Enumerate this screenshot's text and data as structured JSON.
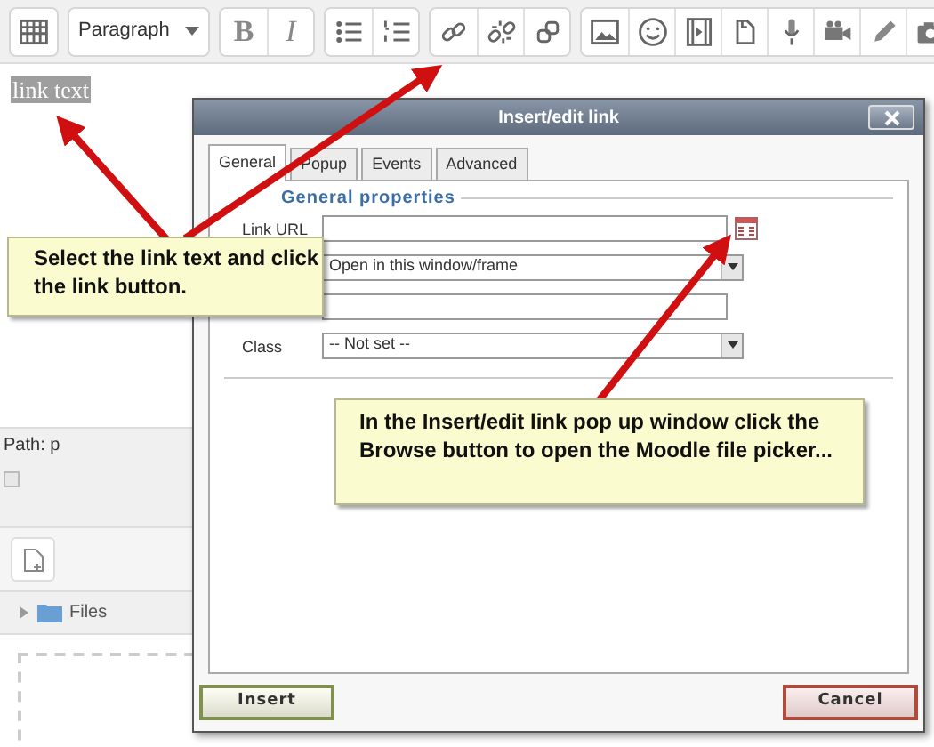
{
  "toolbar": {
    "format_select": "Paragraph",
    "groups": [
      [
        {
          "kind": "grid"
        }
      ],
      [
        {
          "kind": "select"
        }
      ],
      [
        {
          "kind": "bold",
          "label": "B"
        },
        {
          "kind": "italic",
          "label": "I"
        }
      ],
      [
        {
          "kind": "bullets"
        },
        {
          "kind": "numbers"
        }
      ],
      [
        {
          "kind": "link"
        },
        {
          "kind": "unlink"
        },
        {
          "kind": "anchor"
        }
      ],
      [
        {
          "kind": "image"
        },
        {
          "kind": "smiley"
        },
        {
          "kind": "media"
        },
        {
          "kind": "paste"
        },
        {
          "kind": "mic"
        },
        {
          "kind": "video"
        },
        {
          "kind": "pencil"
        },
        {
          "kind": "camera"
        }
      ]
    ]
  },
  "editor": {
    "text": "link text",
    "selected": true
  },
  "path": "Path: p",
  "option_checkbox": {
    "checked": false
  },
  "files": {
    "label": "Files",
    "expanded": false
  },
  "dialog": {
    "title": "Insert/edit link",
    "tabs": [
      {
        "label": "General",
        "selected": true
      },
      {
        "label": "Popup",
        "selected": false
      },
      {
        "label": "Events",
        "selected": false
      },
      {
        "label": "Advanced",
        "selected": false
      }
    ],
    "legend": "General properties",
    "rows": [
      {
        "kind": "text",
        "label": "Link URL",
        "browse": true
      },
      {
        "kind": "select",
        "value": "Open in this window/frame"
      },
      {
        "kind": "text"
      },
      {
        "kind": "select",
        "label": "Class",
        "value": "-- Not set --"
      }
    ],
    "buttons": [
      {
        "kind": "insert",
        "label": "Insert"
      },
      {
        "kind": "cancel",
        "label": "Cancel"
      }
    ]
  },
  "callouts": [
    "Select the link text and click the link button.",
    "In the Insert/edit link pop up window click the Browse button to open the Moodle file picker..."
  ]
}
